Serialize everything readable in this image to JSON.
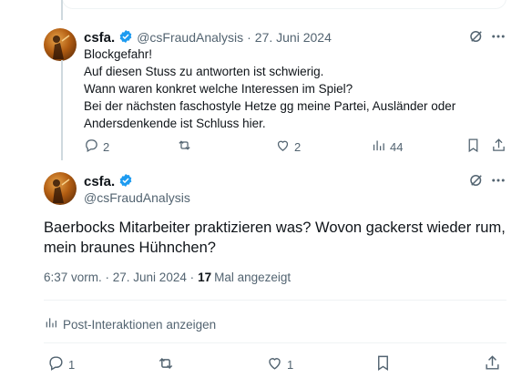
{
  "reply_tweet": {
    "display_name": "csfa.",
    "handle": "@csFraudAnalysis",
    "separator": "·",
    "date": "27. Juni 2024",
    "lines": [
      "Blockgefahr!",
      "Auf diesen Stuss zu antworten ist schwierig.",
      "Wann waren konkret welche Interessen im Spiel?",
      "Bei der nächsten faschostyle Hetze gg meine Partei, Ausländer oder",
      "Andersdenkende ist Schluss hier."
    ],
    "stats": {
      "replies": "2",
      "likes": "2",
      "views": "44"
    }
  },
  "main_tweet": {
    "display_name": "csfa.",
    "handle": "@csFraudAnalysis",
    "text_line1": "Baerbocks Mitarbeiter praktizieren was? Wovon gackerst wieder rum,",
    "text_line2": "mein braunes Hühnchen?",
    "time": "6:37 vorm. · 27. Juni 2024 ·",
    "views_count": "17",
    "views_label": "Mal angezeigt",
    "interactions_label": "Post-Interaktionen anzeigen",
    "stats": {
      "replies": "1",
      "likes": "1"
    }
  },
  "colors": {
    "verified": "#1d9bf0",
    "muted": "#536471",
    "text": "#0f1419",
    "border": "#eff3f4"
  }
}
